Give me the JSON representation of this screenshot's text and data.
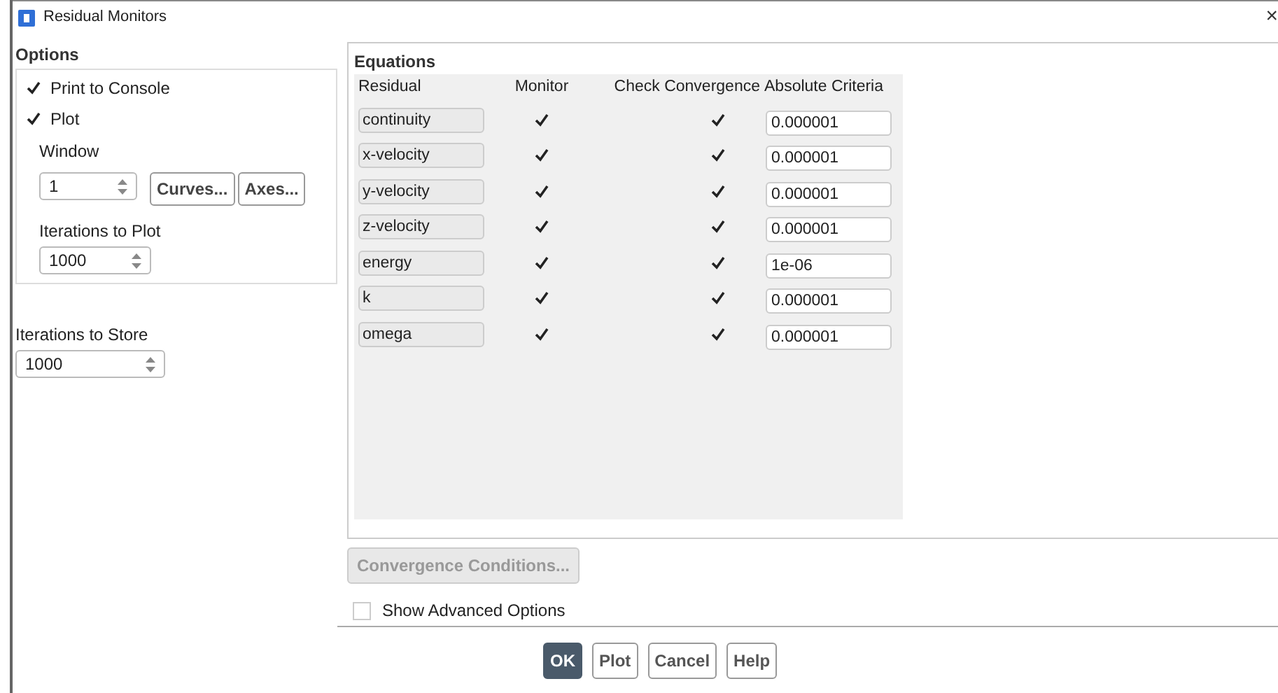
{
  "window": {
    "title": "Residual Monitors",
    "close": "×"
  },
  "options": {
    "title": "Options",
    "checks": [
      {
        "label": "Print to Console",
        "checked": true
      },
      {
        "label": "Plot",
        "checked": true
      }
    ],
    "window_label": "Window",
    "window_value": "1",
    "buttons": [
      "Curves...",
      "Axes..."
    ],
    "iterations_to_plot_label": "Iterations to Plot",
    "iterations_to_plot": "1000"
  },
  "iterations_to_store_label": "Iterations to Store",
  "iterations_to_store": "1000",
  "equations": {
    "title": "Equations",
    "columns": [
      "Residual",
      "Monitor",
      "Check Convergence",
      "Absolute Criteria"
    ],
    "rows": [
      {
        "residual": "continuity",
        "monitor": true,
        "check": true,
        "criteria": "0.000001"
      },
      {
        "residual": "x-velocity",
        "monitor": true,
        "check": true,
        "criteria": "0.000001"
      },
      {
        "residual": "y-velocity",
        "monitor": true,
        "check": true,
        "criteria": "0.000001"
      },
      {
        "residual": "z-velocity",
        "monitor": true,
        "check": true,
        "criteria": "0.000001"
      },
      {
        "residual": "energy",
        "monitor": true,
        "check": true,
        "criteria": "1e-06"
      },
      {
        "residual": "k",
        "monitor": true,
        "check": true,
        "criteria": "0.000001"
      },
      {
        "residual": "omega",
        "monitor": true,
        "check": true,
        "criteria": "0.000001"
      }
    ]
  },
  "convergence_button": {
    "label": "Convergence Conditions...",
    "disabled": true
  },
  "show_advanced": {
    "label": "Show Advanced Options",
    "checked": false
  },
  "footer_buttons": [
    {
      "label": "OK",
      "selected": true
    },
    {
      "label": "Plot",
      "selected": false
    },
    {
      "label": "Cancel",
      "selected": false
    },
    {
      "label": "Help",
      "selected": false
    }
  ]
}
